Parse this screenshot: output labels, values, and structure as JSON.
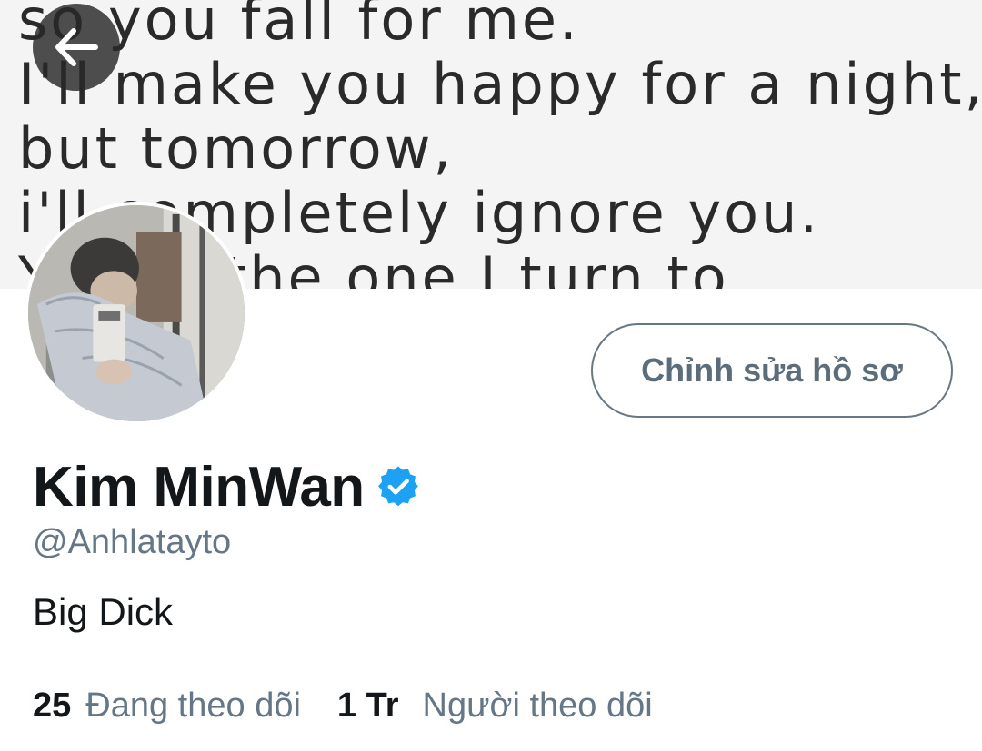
{
  "banner": {
    "lines": [
      "so you fall for me.",
      "I'll make you happy for a night,",
      "but tomorrow,",
      "i'll completely ignore you.",
      "You're the one I turn to"
    ]
  },
  "profile": {
    "display_name": "Kim MinWan",
    "handle": "@Anhlatayto",
    "bio": "Big Dick",
    "verified": true,
    "verified_color": "#1da1f2"
  },
  "actions": {
    "edit_profile_label": "Chỉnh sửa hồ sơ"
  },
  "stats": {
    "following_count": "25",
    "following_label": "Đang theo dõi",
    "followers_count": "1 Tr",
    "followers_label": "Người theo dõi"
  },
  "icons": {
    "back": "arrow-left-icon",
    "verified": "verified-badge-icon"
  }
}
